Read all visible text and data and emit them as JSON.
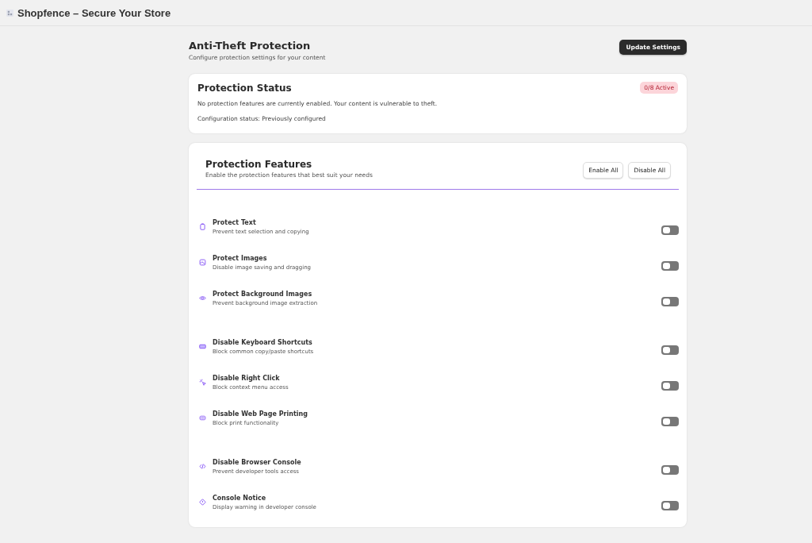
{
  "app_bar": {
    "title": "Shopfence – Secure Your Store"
  },
  "header": {
    "title": "Anti-Theft Protection",
    "subtitle": "Configure protection settings for your content",
    "update_button": "Update Settings"
  },
  "status": {
    "title": "Protection Status",
    "badge": "0/8 Active",
    "message": "No protection features are currently enabled. Your content is vulnerable to theft.",
    "configuration": "Configuration status: Previously configured"
  },
  "features": {
    "title": "Protection Features",
    "subtitle": "Enable the protection features that best suit your needs",
    "enable_all": "Enable All",
    "disable_all": "Disable All",
    "groups": [
      {
        "items": [
          {
            "title": "Protect Text",
            "description": "Prevent text selection and copying",
            "on": false
          },
          {
            "title": "Protect Images",
            "description": "Disable image saving and dragging",
            "on": false
          },
          {
            "title": "Protect Background Images",
            "description": "Prevent background image extraction",
            "on": false
          }
        ]
      },
      {
        "items": [
          {
            "title": "Disable Keyboard Shortcuts",
            "description": "Block common copy/paste shortcuts",
            "on": false
          },
          {
            "title": "Disable Right Click",
            "description": "Block context menu access",
            "on": false
          },
          {
            "title": "Disable Web Page Printing",
            "description": "Block print functionality",
            "on": false
          }
        ]
      },
      {
        "items": [
          {
            "title": "Disable Browser Console",
            "description": "Prevent developer tools access",
            "on": false
          },
          {
            "title": "Console Notice",
            "description": "Display warning in developer console",
            "on": false
          }
        ]
      }
    ]
  }
}
